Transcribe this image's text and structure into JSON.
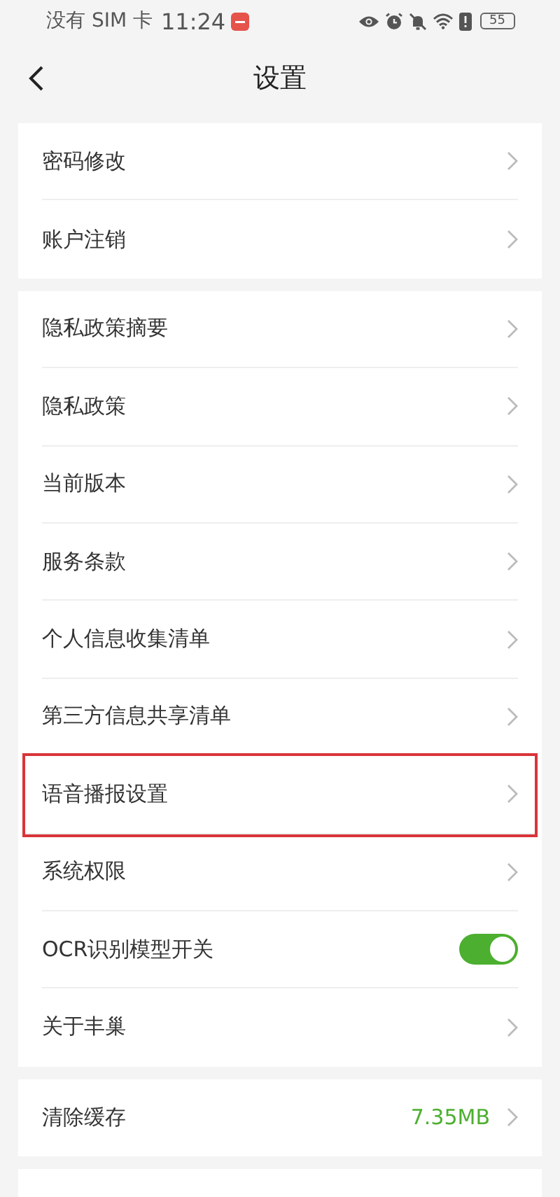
{
  "status_bar": {
    "carrier": "没有 SIM 卡",
    "time": "11:24",
    "battery": "55"
  },
  "header": {
    "title": "设置"
  },
  "groups": [
    {
      "items": [
        {
          "kind": "link",
          "label": "密码修改",
          "highlighted": false
        },
        {
          "kind": "link",
          "label": "账户注销",
          "highlighted": false
        }
      ]
    },
    {
      "items": [
        {
          "kind": "link",
          "label": "隐私政策摘要",
          "highlighted": false
        },
        {
          "kind": "link",
          "label": "隐私政策",
          "highlighted": false
        },
        {
          "kind": "link",
          "label": "当前版本",
          "highlighted": false
        },
        {
          "kind": "link",
          "label": "服务条款",
          "highlighted": false
        },
        {
          "kind": "link",
          "label": "个人信息收集清单",
          "highlighted": false
        },
        {
          "kind": "link",
          "label": "第三方信息共享清单",
          "highlighted": false
        },
        {
          "kind": "link",
          "label": "语音播报设置",
          "highlighted": true
        },
        {
          "kind": "link",
          "label": "系统权限",
          "highlighted": false
        },
        {
          "kind": "toggle",
          "label": "OCR识别模型开关",
          "on": true,
          "highlighted": false
        },
        {
          "kind": "link",
          "label": "关于丰巢",
          "highlighted": false
        }
      ]
    },
    {
      "items": [
        {
          "kind": "value",
          "label": "清除缓存",
          "value": "7.35MB",
          "highlighted": false
        }
      ]
    }
  ]
}
